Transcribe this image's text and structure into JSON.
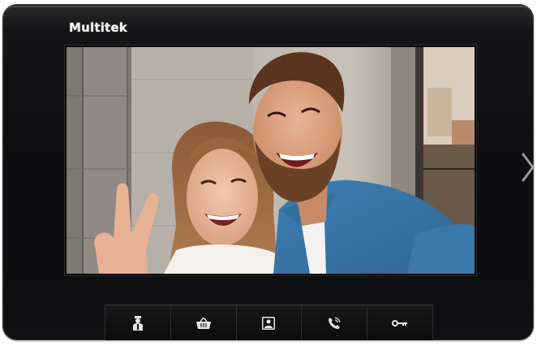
{
  "device": {
    "brand": "Multitek"
  },
  "screen": {
    "content": "video-feed-image"
  },
  "navigation": {
    "next_icon": "chevron-right-icon"
  },
  "buttons": [
    {
      "icon": "concierge-icon"
    },
    {
      "icon": "basket-icon"
    },
    {
      "icon": "photo-icon"
    },
    {
      "icon": "phone-call-icon"
    },
    {
      "icon": "key-icon"
    }
  ],
  "colors": {
    "bezel": "#0d0d0f",
    "icon": "#e6e6e6",
    "arrow": "#9a9a9a"
  }
}
